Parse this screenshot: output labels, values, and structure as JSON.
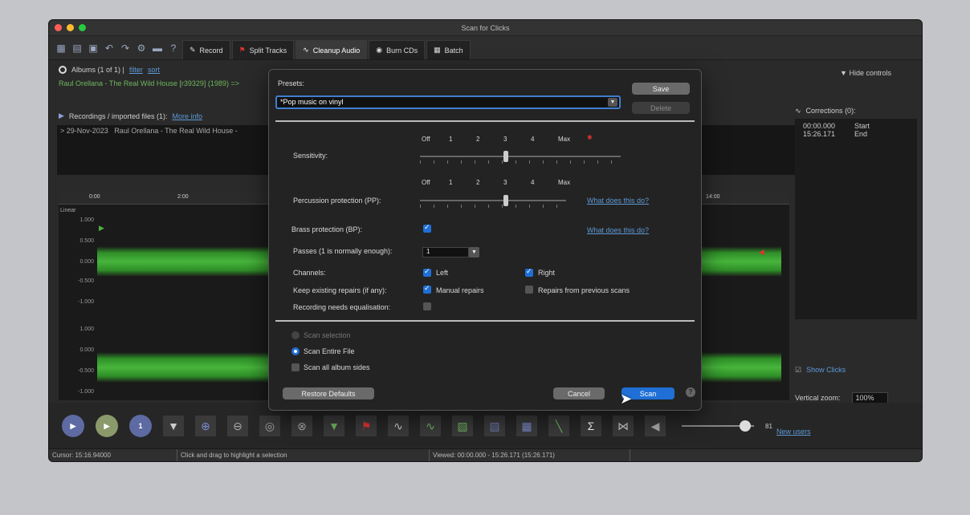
{
  "window": {
    "title": "Scan for Clicks"
  },
  "toolbar": {
    "tabs": [
      "Record",
      "Split Tracks",
      "Cleanup Audio",
      "Burn CDs",
      "Batch"
    ]
  },
  "albums": {
    "label": "Albums (1 of 1) |",
    "filter": "filter",
    "sort": "sort",
    "current": "Raul Orellana - The Real Wild House [r39329] (1989) =>",
    "hide_controls": "Hide controls"
  },
  "recordings": {
    "label": "Recordings / imported files (1):",
    "more_info": "More info",
    "entry_date": "29-Nov-2023",
    "entry_title": "Raul Orellana - The Real Wild House -"
  },
  "corrections": {
    "label": "Corrections (0):",
    "rows": [
      {
        "time": "00:00.000",
        "label": "Start"
      },
      {
        "time": "15:26.171",
        "label": "End"
      }
    ],
    "show_clicks": "Show Clicks",
    "vertical_zoom_label": "Vertical zoom:",
    "vertical_zoom_value": "100%"
  },
  "waveform": {
    "scale": "Linear",
    "ruler": [
      "0:00",
      "2:00",
      "14:00"
    ],
    "axis_labels": [
      "1.000",
      "0.500",
      "0.000",
      "-0.500",
      "-1.000"
    ]
  },
  "dialog": {
    "presets_label": "Presets:",
    "preset_value": "*Pop music on vinyl",
    "save": "Save",
    "delete": "Delete",
    "sensitivity_label": "Sensitivity:",
    "sensitivity_ticks": [
      "Off",
      "1",
      "2",
      "3",
      "4",
      "Max"
    ],
    "sensitivity_level": 3,
    "percussion_label": "Percussion protection (PP):",
    "percussion_ticks": [
      "Off",
      "1",
      "2",
      "3",
      "4",
      "Max"
    ],
    "percussion_level": 3,
    "brass_label": "Brass protection (BP):",
    "what_does": "What does this do?",
    "passes_label": "Passes (1 is normally enough):",
    "passes_value": "1",
    "channels_label": "Channels:",
    "left": "Left",
    "right": "Right",
    "keep_label": "Keep existing repairs (if any):",
    "manual_repairs": "Manual repairs",
    "prev_repairs": "Repairs from previous scans",
    "eq_label": "Recording needs equalisation:",
    "scan_selection": "Scan selection",
    "scan_entire": "Scan Entire File",
    "scan_all_sides": "Scan all album sides",
    "restore": "Restore Defaults",
    "cancel": "Cancel",
    "scan": "Scan"
  },
  "bottom": {
    "volume": "81",
    "new_users": "New users"
  },
  "status": {
    "cursor": "Cursor: 15:16.94000",
    "hint": "Click and drag to highlight a selection",
    "viewed": "Viewed: 00:00.000 - 15:26.171 (15:26.171)"
  }
}
